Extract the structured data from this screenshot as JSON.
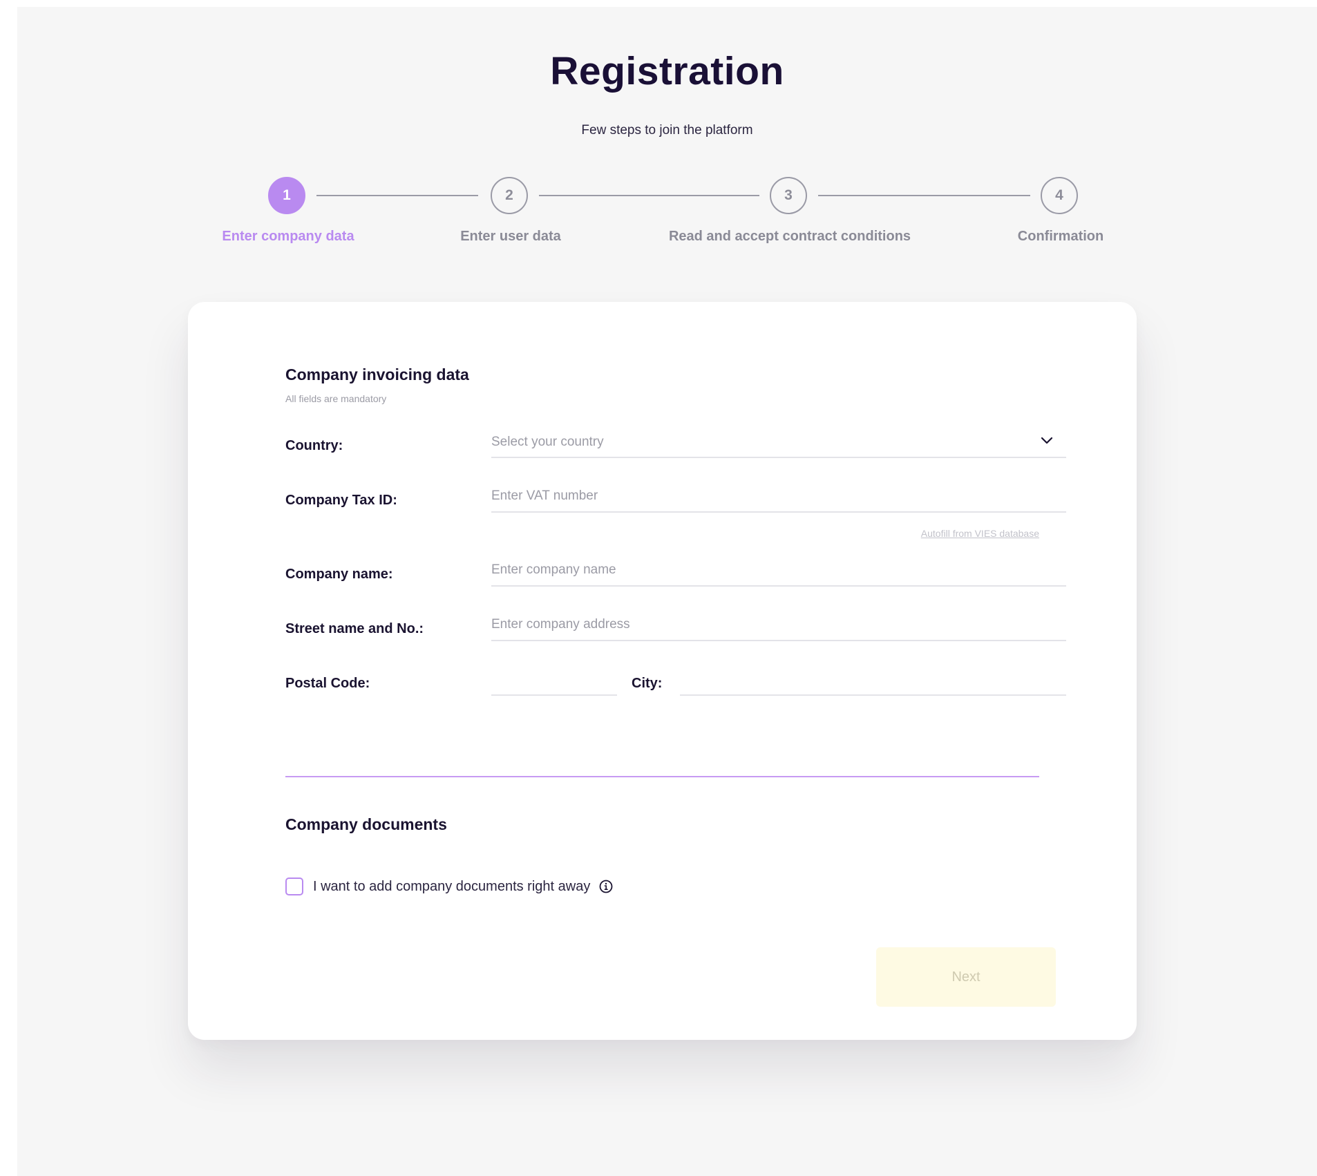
{
  "header": {
    "title": "Registration",
    "subtitle": "Few steps to join the platform"
  },
  "stepper": {
    "steps": [
      {
        "number": "1",
        "label": "Enter company data"
      },
      {
        "number": "2",
        "label": "Enter user data"
      },
      {
        "number": "3",
        "label": "Read and accept contract conditions"
      },
      {
        "number": "4",
        "label": "Confirmation"
      }
    ]
  },
  "form": {
    "invoicing_title": "Company invoicing data",
    "mandatory_note": "All fields are mandatory",
    "country": {
      "label": "Country:",
      "placeholder": "Select your country"
    },
    "tax_id": {
      "label": "Company Tax ID:",
      "placeholder": "Enter VAT number"
    },
    "autofill_link": "Autofill from VIES database",
    "company_name": {
      "label": "Company name:",
      "placeholder": "Enter company name"
    },
    "street": {
      "label": "Street name and No.:",
      "placeholder": "Enter company address"
    },
    "postal_code": {
      "label": "Postal Code:",
      "placeholder": ""
    },
    "city": {
      "label": "City:",
      "placeholder": ""
    },
    "documents_title": "Company documents",
    "documents_checkbox_label": "I want to add company documents right away",
    "next_button": "Next"
  },
  "colors": {
    "accent": "#b98af0",
    "background": "#f6f6f6",
    "card": "#ffffff",
    "next_button_bg": "#fefae3"
  },
  "icons": {
    "dropdown": "chevron-down-icon",
    "info": "info-icon"
  }
}
